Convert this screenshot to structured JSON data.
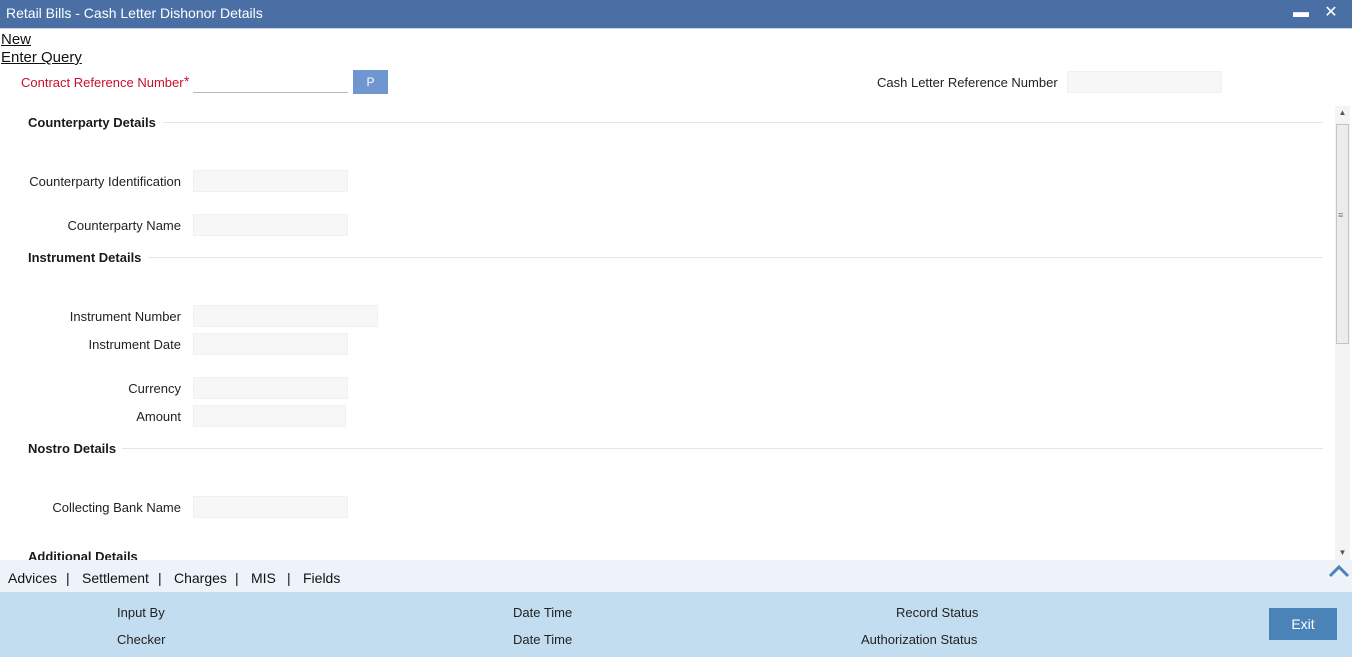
{
  "window": {
    "title": "Retail Bills - Cash Letter Dishonor Details",
    "minimize_glyph": "▬",
    "close_glyph": "✕"
  },
  "menu": {
    "new": "New",
    "enter_query": "Enter Query"
  },
  "header": {
    "contract_ref_label": "Contract Reference Number",
    "required_mark": "*",
    "contract_ref_value": "",
    "p_button": "P",
    "cash_letter_label": "Cash Letter Reference Number",
    "cash_letter_value": ""
  },
  "sections": {
    "counterparty": "Counterparty Details",
    "instrument": "Instrument Details",
    "nostro": "Nostro Details",
    "additional": "Additional Details"
  },
  "fields": {
    "counterparty_id": {
      "label": "Counterparty Identification",
      "value": ""
    },
    "counterparty_name": {
      "label": "Counterparty Name",
      "value": ""
    },
    "instrument_number": {
      "label": "Instrument Number",
      "value": ""
    },
    "instrument_date": {
      "label": "Instrument Date",
      "value": ""
    },
    "currency": {
      "label": "Currency",
      "value": ""
    },
    "amount": {
      "label": "Amount",
      "value": ""
    },
    "collecting_bank": {
      "label": "Collecting Bank Name",
      "value": ""
    }
  },
  "tabs": [
    "Advices",
    "Settlement",
    "Charges",
    "MIS",
    "Fields"
  ],
  "tab_separator": "|",
  "footer": {
    "input_by": "Input By",
    "checker": "Checker",
    "date_time_1": "Date Time",
    "date_time_2": "Date Time",
    "record_status": "Record Status",
    "authorization_status": "Authorization Status",
    "exit": "Exit"
  },
  "colors": {
    "titlebar": "#4a6fa5",
    "required": "#c8102e",
    "footer": "#c3ddf0",
    "exit_button": "#4a83b7",
    "p_button": "#6f96d1"
  }
}
